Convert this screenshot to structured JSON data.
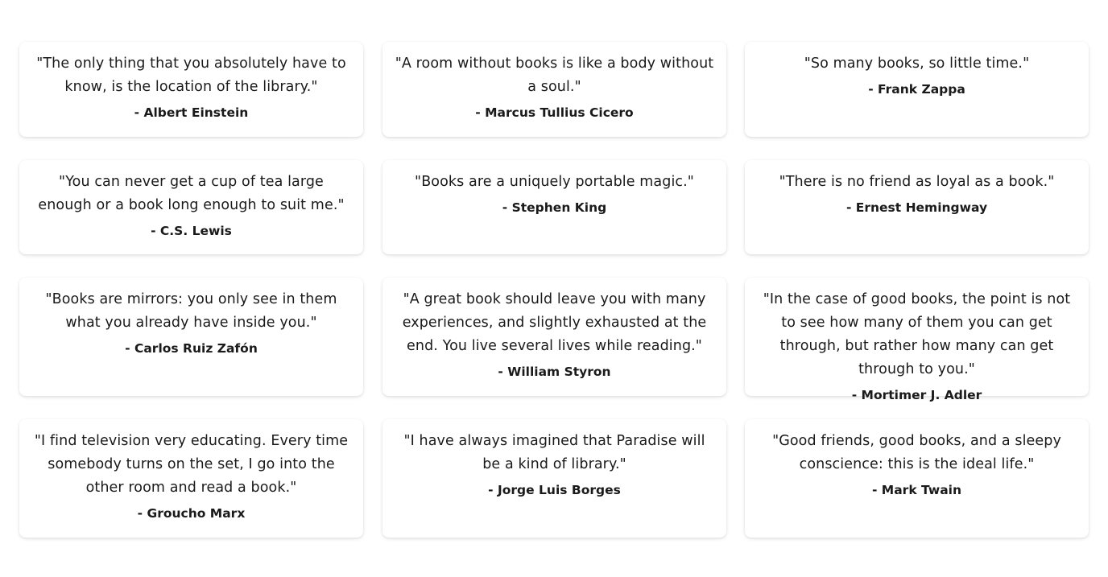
{
  "quotes": [
    {
      "text": "\"The only thing that you absolutely have to know, is the location of the library.\"",
      "author": "- Albert Einstein"
    },
    {
      "text": "\"A room without books is like a body without a soul.\"",
      "author": "- Marcus Tullius Cicero"
    },
    {
      "text": "\"So many books, so little time.\"",
      "author": "- Frank Zappa"
    },
    {
      "text": "\"You can never get a cup of tea large enough or a book long enough to suit me.\"",
      "author": "- C.S. Lewis"
    },
    {
      "text": "\"Books are a uniquely portable magic.\"",
      "author": "- Stephen King"
    },
    {
      "text": "\"There is no friend as loyal as a book.\"",
      "author": "- Ernest Hemingway"
    },
    {
      "text": "\"Books are mirrors: you only see in them what you already have inside you.\"",
      "author": "- Carlos Ruiz Zafón"
    },
    {
      "text": "\"A great book should leave you with many experiences, and slightly exhausted at the end. You live several lives while reading.\"",
      "author": "- William Styron"
    },
    {
      "text": "\"In the case of good books, the point is not to see how many of them you can get through, but rather how many can get through to you.\"",
      "author": "- Mortimer J. Adler"
    },
    {
      "text": "\"I find television very educating. Every time somebody turns on the set, I go into the other room and read a book.\"",
      "author": "- Groucho Marx"
    },
    {
      "text": "\"I have always imagined that Paradise will be a kind of library.\"",
      "author": "- Jorge Luis Borges"
    },
    {
      "text": "\"Good friends, good books, and a sleepy conscience: this is the ideal life.\"",
      "author": "- Mark Twain"
    }
  ]
}
